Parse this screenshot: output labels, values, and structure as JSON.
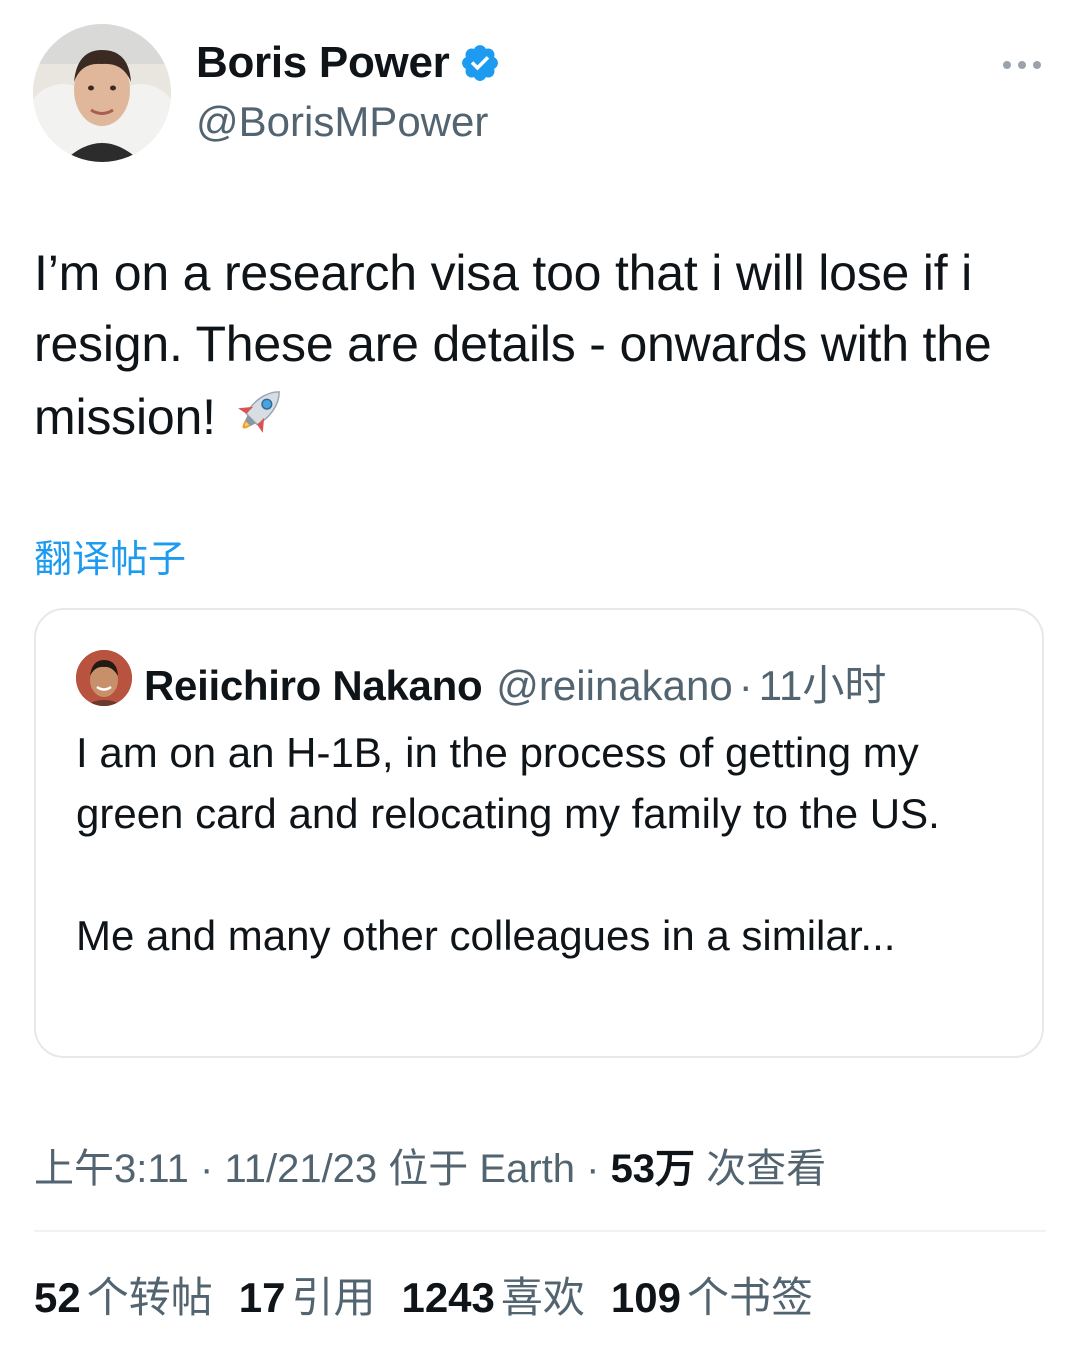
{
  "author": {
    "name": "Boris Power",
    "handle": "@BorisMPower",
    "verified": true
  },
  "tweet": {
    "text": "I’m on a research visa too that i will lose if i resign. These are details - onwards with the mission!",
    "emoji_icon": "rocket-emoji-icon"
  },
  "translate_label": "翻译帖子",
  "quote": {
    "name": "Reiichiro Nakano",
    "handle": "@reiinakano",
    "separator": "·",
    "time": "11小时",
    "paragraph1": "I am on an H-1B, in the process of getting my green card and relocating my family to the US.",
    "paragraph2": "Me and many other colleagues in a similar..."
  },
  "meta": {
    "time": "上午3:11",
    "sep1": " · ",
    "date": "11/21/23",
    "location": " 位于 Earth",
    "sep2": " · ",
    "views_count": "53万",
    "views_label": " 次查看"
  },
  "stats": [
    {
      "count": "52",
      "label": "个转帖"
    },
    {
      "count": "17",
      "label": "引用"
    },
    {
      "count": "1243",
      "label": "喜欢"
    },
    {
      "count": "109",
      "label": "个书签"
    }
  ],
  "colors": {
    "link": "#1d9bf0",
    "secondary": "#536471",
    "primary": "#0f1419",
    "border": "#e6e9ec"
  }
}
